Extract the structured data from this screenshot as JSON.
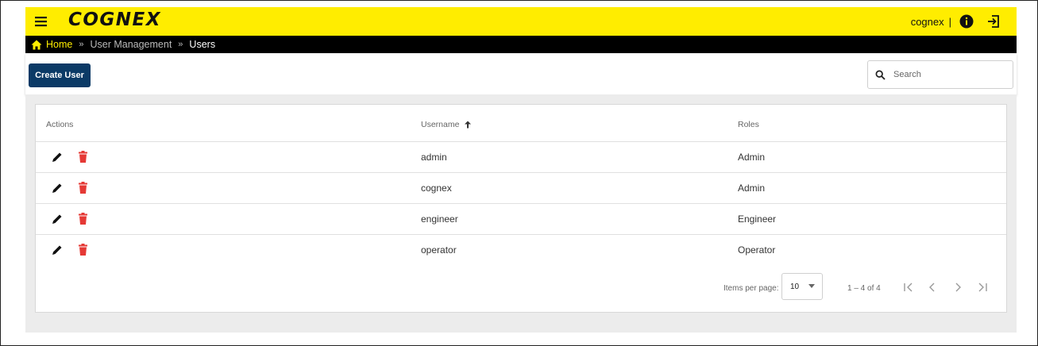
{
  "header": {
    "brand": "COGNEX",
    "username": "cognex",
    "separator": "|",
    "icons": [
      "menu-icon",
      "info-icon",
      "logout-icon"
    ]
  },
  "breadcrumb": {
    "home": "Home",
    "separator": "»",
    "section": "User Management",
    "current": "Users"
  },
  "toolbar": {
    "create_label": "Create User",
    "search_placeholder": "Search"
  },
  "table": {
    "columns": [
      "Actions",
      "Username",
      "Roles"
    ],
    "sort": {
      "column": "Username",
      "direction": "ascending"
    },
    "rows": [
      {
        "username": "admin",
        "role": "Admin"
      },
      {
        "username": "cognex",
        "role": "Admin"
      },
      {
        "username": "engineer",
        "role": "Engineer"
      },
      {
        "username": "operator",
        "role": "Operator"
      }
    ]
  },
  "paginator": {
    "items_per_page_label": "Items per page:",
    "items_per_page": "10",
    "range_label": "1 – 4 of 4"
  },
  "colors": {
    "brand_yellow": "#ffed00",
    "primary_button": "#0b3a66",
    "delete_red": "#e53935"
  }
}
